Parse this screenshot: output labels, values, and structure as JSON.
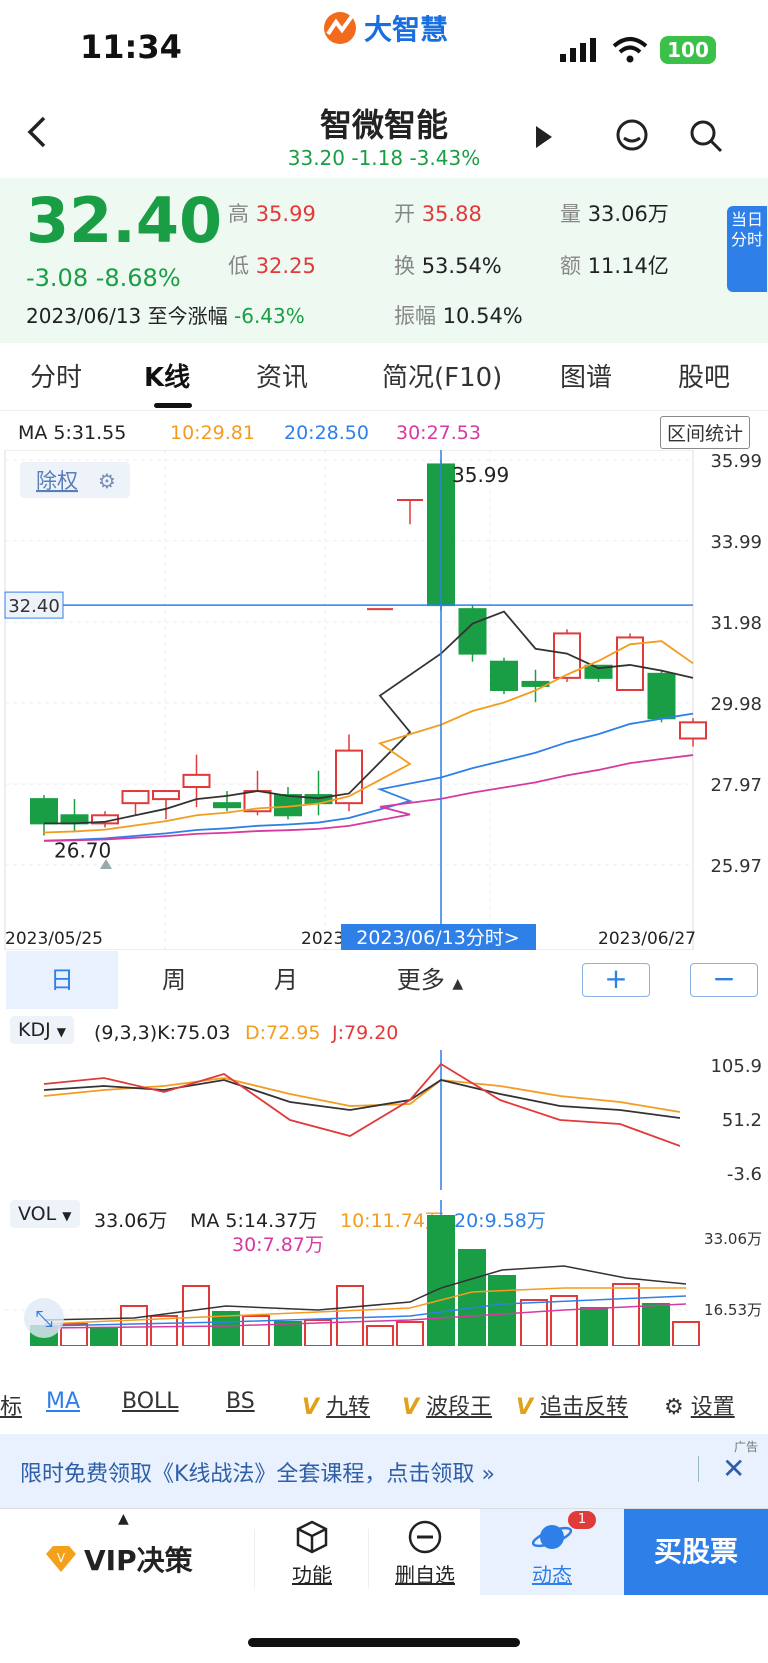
{
  "status": {
    "time": "11:34",
    "battery": "100",
    "logo": "大智慧"
  },
  "nav": {
    "title": "智微智能",
    "subtitle": "33.20  -1.18  -3.43%"
  },
  "quote": {
    "price": "32.40",
    "change": "-3.08  -8.68%",
    "date_text": "2023/06/13  至今涨幅",
    "since_change": "-6.43%",
    "high_label": "高",
    "high": "35.99",
    "open_label": "开",
    "open": "35.88",
    "vol_label": "量",
    "vol": "33.06万",
    "low_label": "低",
    "low": "32.25",
    "turnover_label": "换",
    "turnover": "53.54%",
    "amount_label": "额",
    "amount": "11.14亿",
    "amplitude_label": "振幅",
    "amplitude": "10.54%",
    "side_label": "当日分时"
  },
  "tabs": [
    "分时",
    "K线",
    "资讯",
    "简况(F10)",
    "图谱",
    "股吧"
  ],
  "ma_legend": {
    "ma5": "MA 5:31.55",
    "ma10": "10:29.81",
    "ma20": "20:28.50",
    "ma30": "30:27.53",
    "range_btn": "区间统计"
  },
  "chart": {
    "adjust_label": "除权",
    "price_axis": [
      "35.99",
      "33.99",
      "31.98",
      "29.98",
      "27.97",
      "25.97"
    ],
    "crosshair_price": "32.40",
    "high_mark": "35.99",
    "low_mark": "26.70",
    "date_left": "2023/05/25",
    "date_mid": "2023",
    "date_cross": "2023/06/13分时>",
    "date_right": "2023/06/27"
  },
  "chart_data": {
    "type": "candlestick",
    "dates_shown": [
      "2023/05/25",
      "2023/06/13",
      "2023/06/27"
    ],
    "candles": [
      {
        "o": 27.6,
        "c": 27.0,
        "h": 27.7,
        "l": 26.7
      },
      {
        "o": 27.2,
        "c": 27.0,
        "h": 27.6,
        "l": 26.8
      },
      {
        "o": 27.0,
        "c": 27.2,
        "h": 27.3,
        "l": 26.9
      },
      {
        "o": 27.5,
        "c": 27.8,
        "h": 27.8,
        "l": 27.2
      },
      {
        "o": 27.6,
        "c": 27.8,
        "h": 27.8,
        "l": 27.1
      },
      {
        "o": 27.9,
        "c": 28.2,
        "h": 28.7,
        "l": 27.4
      },
      {
        "o": 27.5,
        "c": 27.4,
        "h": 27.8,
        "l": 27.3
      },
      {
        "o": 27.3,
        "c": 27.8,
        "h": 28.3,
        "l": 27.2
      },
      {
        "o": 27.7,
        "c": 27.2,
        "h": 27.9,
        "l": 27.1
      },
      {
        "o": 27.7,
        "c": 27.5,
        "h": 28.3,
        "l": 27.2
      },
      {
        "o": 27.5,
        "c": 28.8,
        "h": 29.2,
        "l": 27.3
      },
      {
        "o": 35.0,
        "c": 35.0,
        "h": 35.0,
        "l": 34.4
      },
      {
        "o": 32.3,
        "c": 32.3,
        "h": 32.3,
        "l": 32.3
      },
      {
        "o": 35.88,
        "c": 32.4,
        "h": 35.99,
        "l": 32.25
      },
      {
        "o": 32.3,
        "c": 31.2,
        "h": 32.4,
        "l": 31.0
      },
      {
        "o": 31.0,
        "c": 30.3,
        "h": 31.1,
        "l": 30.2
      },
      {
        "o": 30.5,
        "c": 30.4,
        "h": 30.8,
        "l": 30.0
      },
      {
        "o": 30.6,
        "c": 31.7,
        "h": 31.8,
        "l": 30.5
      },
      {
        "o": 30.9,
        "c": 30.6,
        "h": 30.9,
        "l": 30.5
      },
      {
        "o": 30.3,
        "c": 31.6,
        "h": 31.7,
        "l": 30.4
      },
      {
        "o": 30.7,
        "c": 29.6,
        "h": 30.8,
        "l": 29.5
      },
      {
        "o": 29.1,
        "c": 29.5,
        "h": 29.6,
        "l": 28.9
      }
    ],
    "ylim": [
      25.97,
      35.99
    ]
  },
  "periods": {
    "day": "日",
    "week": "周",
    "month": "月",
    "more": "更多",
    "plus": "+",
    "minus": "−"
  },
  "kdj": {
    "btn": "KDJ",
    "params": "(9,3,3)K:75.03",
    "d": "D:72.95",
    "j": "J:79.20",
    "axis": [
      "105.9",
      "51.2",
      "-3.6"
    ]
  },
  "vol": {
    "btn": "VOL",
    "value": "33.06万",
    "ma5": "MA 5:14.37万",
    "ma10": "10:11.74万",
    "ma20": "20:9.58万",
    "ma30": "30:7.87万",
    "axis": [
      "33.06万",
      "16.53万"
    ]
  },
  "indicators": [
    "标",
    "MA",
    "BOLL",
    "BS",
    "九转",
    "波段王",
    "追击反转",
    "设置"
  ],
  "banner": {
    "text": "限时免费领取《K线战法》全套课程，点击领取",
    "ad": "广告"
  },
  "bottom": {
    "vip": "VIP决策",
    "func": "功能",
    "remove": "删自选",
    "dynamic": "动态",
    "badge": "1",
    "buy": "买股票"
  },
  "colors": {
    "up": "#e03a3a",
    "down": "#1a9e45",
    "accent": "#2f7fe8",
    "ma5": "#333333",
    "ma10": "#f39c1f",
    "ma20": "#2f7fe8",
    "ma30": "#d63aa0"
  }
}
